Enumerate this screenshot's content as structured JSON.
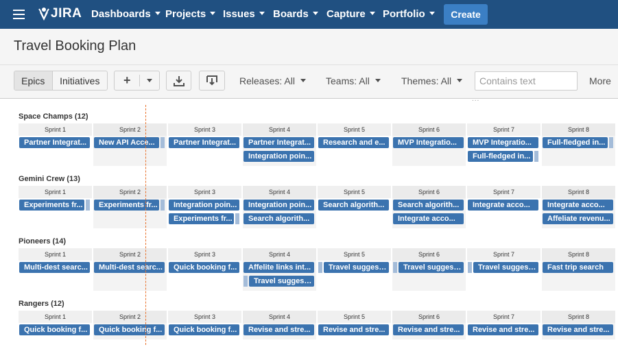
{
  "nav": {
    "logo": "JIRA",
    "items": [
      "Dashboards",
      "Projects",
      "Issues",
      "Boards",
      "Capture",
      "Portfolio"
    ],
    "create_label": "Create"
  },
  "page": {
    "title": "Travel Booking Plan"
  },
  "toolbar": {
    "view_tabs": [
      "Epics",
      "Initiatives"
    ],
    "add_label": "+",
    "filters": [
      "Releases: All",
      "Teams: All",
      "Themes: All"
    ],
    "search_placeholder": "Contains text",
    "more_label": "More",
    "resize_handle": "..."
  },
  "colors": {
    "nav": "#205081",
    "bar": "#3b73af",
    "today_line": "#e8702a"
  },
  "teams": [
    {
      "name": "Space Champs (12)",
      "sprints": [
        "Sprint 1",
        "Sprint 2",
        "Sprint 3",
        "Sprint 4",
        "Sprint 5",
        "Sprint 6",
        "Sprint 7",
        "Sprint 8"
      ],
      "rows": [
        [
          {
            "sprint": 0,
            "label": "Partner Integrat...",
            "tick": "none"
          },
          {
            "sprint": 1,
            "label": "New API Acce...",
            "tick": "right"
          },
          {
            "sprint": 2,
            "label": "Partner Integrat...",
            "tick": "none"
          },
          {
            "sprint": 3,
            "label": "Partner Integrat...",
            "tick": "none"
          },
          {
            "sprint": 4,
            "label": "Research and e...",
            "tick": "none"
          },
          {
            "sprint": 5,
            "label": "MVP Integratio...",
            "tick": "none"
          },
          {
            "sprint": 6,
            "label": "MVP Integratio...",
            "tick": "none"
          },
          {
            "sprint": 7,
            "label": "Full-fledged in...",
            "tick": "right"
          }
        ],
        [
          {
            "sprint": 3,
            "label": "Integration poin...",
            "tick": "none"
          },
          {
            "sprint": 6,
            "label": "Full-fledged in...",
            "tick": "right"
          }
        ]
      ]
    },
    {
      "name": "Gemini Crew (13)",
      "sprints": [
        "Sprint 1",
        "Sprint 2",
        "Sprint 3",
        "Sprint 4",
        "Sprint 5",
        "Sprint 6",
        "Sprint 7",
        "Sprint 8"
      ],
      "rows": [
        [
          {
            "sprint": 0,
            "label": "Experiments fr...",
            "tick": "right"
          },
          {
            "sprint": 1,
            "label": "Experiments fr...",
            "tick": "right"
          },
          {
            "sprint": 2,
            "label": "Integration poin...",
            "tick": "none"
          },
          {
            "sprint": 3,
            "label": "Integration poin...",
            "tick": "none"
          },
          {
            "sprint": 4,
            "label": "Search algorith...",
            "tick": "none"
          },
          {
            "sprint": 5,
            "label": "Search algorith...",
            "tick": "none"
          },
          {
            "sprint": 6,
            "label": "Integrate acco...",
            "tick": "none"
          },
          {
            "sprint": 7,
            "label": "Integrate acco...",
            "tick": "none"
          }
        ],
        [
          {
            "sprint": 2,
            "label": "Experiments fr...",
            "tick": "right"
          },
          {
            "sprint": 3,
            "label": "Search algorith...",
            "tick": "none"
          },
          {
            "sprint": 5,
            "label": "Integrate acco...",
            "tick": "none"
          },
          {
            "sprint": 7,
            "label": "Affeliate revenu...",
            "tick": "none"
          }
        ]
      ]
    },
    {
      "name": "Pioneers (14)",
      "sprints": [
        "Sprint 1",
        "Sprint 2",
        "Sprint 3",
        "Sprint 4",
        "Sprint 5",
        "Sprint 6",
        "Sprint 7",
        "Sprint 8"
      ],
      "rows": [
        [
          {
            "sprint": 0,
            "label": "Multi-dest searc...",
            "tick": "none"
          },
          {
            "sprint": 1,
            "label": "Multi-dest searc...",
            "tick": "none"
          },
          {
            "sprint": 2,
            "label": "Quick booking f...",
            "tick": "none"
          },
          {
            "sprint": 3,
            "label": "Affelite links int...",
            "tick": "none"
          },
          {
            "sprint": 4,
            "label": "Travel suggesti...",
            "tick": "left"
          },
          {
            "sprint": 5,
            "label": "Travel suggesti...",
            "tick": "left"
          },
          {
            "sprint": 6,
            "label": "Travel suggesti...",
            "tick": "left"
          },
          {
            "sprint": 7,
            "label": "Fast trip search",
            "tick": "none"
          }
        ],
        [
          {
            "sprint": 3,
            "label": "Travel suggesti...",
            "tick": "left"
          }
        ]
      ]
    },
    {
      "name": "Rangers (12)",
      "sprints": [
        "Sprint 1",
        "Sprint 2",
        "Sprint 3",
        "Sprint 4",
        "Sprint 5",
        "Sprint 6",
        "Sprint 7",
        "Sprint 8"
      ],
      "rows": [
        [
          {
            "sprint": 0,
            "label": "Quick booking f...",
            "tick": "none"
          },
          {
            "sprint": 1,
            "label": "Quick booking f...",
            "tick": "none"
          },
          {
            "sprint": 2,
            "label": "Quick booking f...",
            "tick": "none"
          },
          {
            "sprint": 3,
            "label": "Revise and stre...",
            "tick": "none"
          },
          {
            "sprint": 4,
            "label": "Revise and stre...",
            "tick": "none"
          },
          {
            "sprint": 5,
            "label": "Revise and stre...",
            "tick": "none"
          },
          {
            "sprint": 6,
            "label": "Revise and stre...",
            "tick": "none"
          },
          {
            "sprint": 7,
            "label": "Revise and stre...",
            "tick": "none"
          }
        ]
      ]
    }
  ]
}
